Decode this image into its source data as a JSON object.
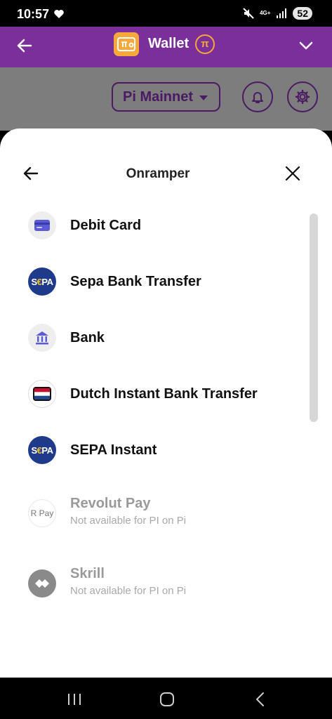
{
  "status_bar": {
    "time": "10:57",
    "network": "4G+",
    "battery": "52"
  },
  "header": {
    "title": "Wallet"
  },
  "toolbar": {
    "network_selected": "Pi Mainnet"
  },
  "sheet": {
    "title": "Onramper",
    "methods": [
      {
        "label": "Debit Card",
        "icon": "debit-card-icon",
        "available": true
      },
      {
        "label": "Sepa Bank Transfer",
        "icon": "sepa-icon",
        "available": true
      },
      {
        "label": "Bank",
        "icon": "bank-icon",
        "available": true
      },
      {
        "label": "Dutch Instant Bank Transfer",
        "icon": "netherlands-flag-icon",
        "available": true
      },
      {
        "label": "SEPA Instant",
        "icon": "sepa-icon",
        "available": true
      },
      {
        "label": "Revolut Pay",
        "icon": "revolut-pay-icon",
        "available": false,
        "note": "Not available for PI on Pi"
      },
      {
        "label": "Skrill",
        "icon": "skrill-icon",
        "available": false,
        "note": "Not available for PI on Pi"
      }
    ],
    "sepa_logo_text": {
      "s": "S",
      "euro": "€",
      "pa": "PA"
    },
    "revolut_logo_text": "R Pay"
  },
  "colors": {
    "header_bg": "#7a2f9a",
    "accent_orange": "#f6a83b",
    "dim_overlay": "#7d7d7d",
    "sepa_blue": "#1f3a8a",
    "dark_purple": "#4a1a63"
  }
}
